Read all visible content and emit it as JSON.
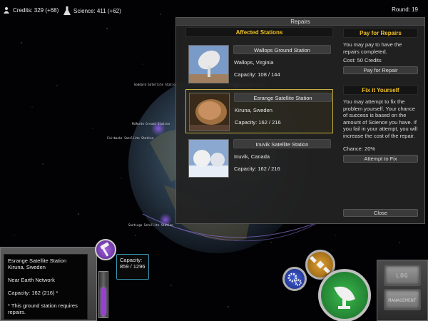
{
  "hud": {
    "credits": "Credits: 329 (+68)",
    "science": "Science: 411 (+62)",
    "round": "Round: 19"
  },
  "repairs": {
    "title": "Repairs",
    "affected_header": "Affected Stations",
    "stations": [
      {
        "name": "Wallops Ground Station",
        "location": "Wallops, Virginia",
        "capacity": "Capacity: 108 / 144"
      },
      {
        "name": "Esrange Satellite Station",
        "location": "Kiruna, Sweden",
        "capacity": "Capacity: 162 / 216"
      },
      {
        "name": "Inuvik Satellite Station",
        "location": "Inuvik, Canada",
        "capacity": "Capacity: 162 / 216"
      }
    ],
    "pay": {
      "header": "Pay for Repairs",
      "description": "You may pay to have the repairs completed.",
      "cost": "Cost: 50 Credits",
      "button": "Pay for Repair"
    },
    "fix": {
      "header": "Fix it Yourself",
      "description": "You may attempt to fix the problem yourself. Your chance of success is based on the amount of Science you have. If you fail in your attempt, you will increase the cost of the repair.",
      "chance": "Chance: 20%",
      "button": "Attempt to Fix"
    },
    "close": "Close"
  },
  "globe_labels": {
    "a": "Goddard Satellite Station",
    "b": "Wallops Ground Station",
    "c": "McMurdo Ground Station",
    "d": "Santiago Satellite Station",
    "e": "Fairbanks Satellite Station"
  },
  "info": {
    "name": "Esrange Satellite Station",
    "location": "Kiruna, Sweden",
    "network": "Near Earth Network",
    "capacity": "Capacity: 162 (216) *",
    "note": "* This ground station requires repairs."
  },
  "capacity_box": {
    "label": "Capacity:",
    "value": "859 / 1296",
    "fill_fraction": 0.66
  },
  "side_buttons": {
    "log": "LOG",
    "management": "MANAGEMENT"
  },
  "colors": {
    "accent": "#f0c020",
    "purple": "#9a40d0",
    "teal": "#3a9ab0",
    "green": "#2a9a3a"
  },
  "icons": [
    "credits-icon",
    "science-icon",
    "hammer-icon",
    "satellite-icon",
    "gears-icon",
    "dish-icon"
  ]
}
